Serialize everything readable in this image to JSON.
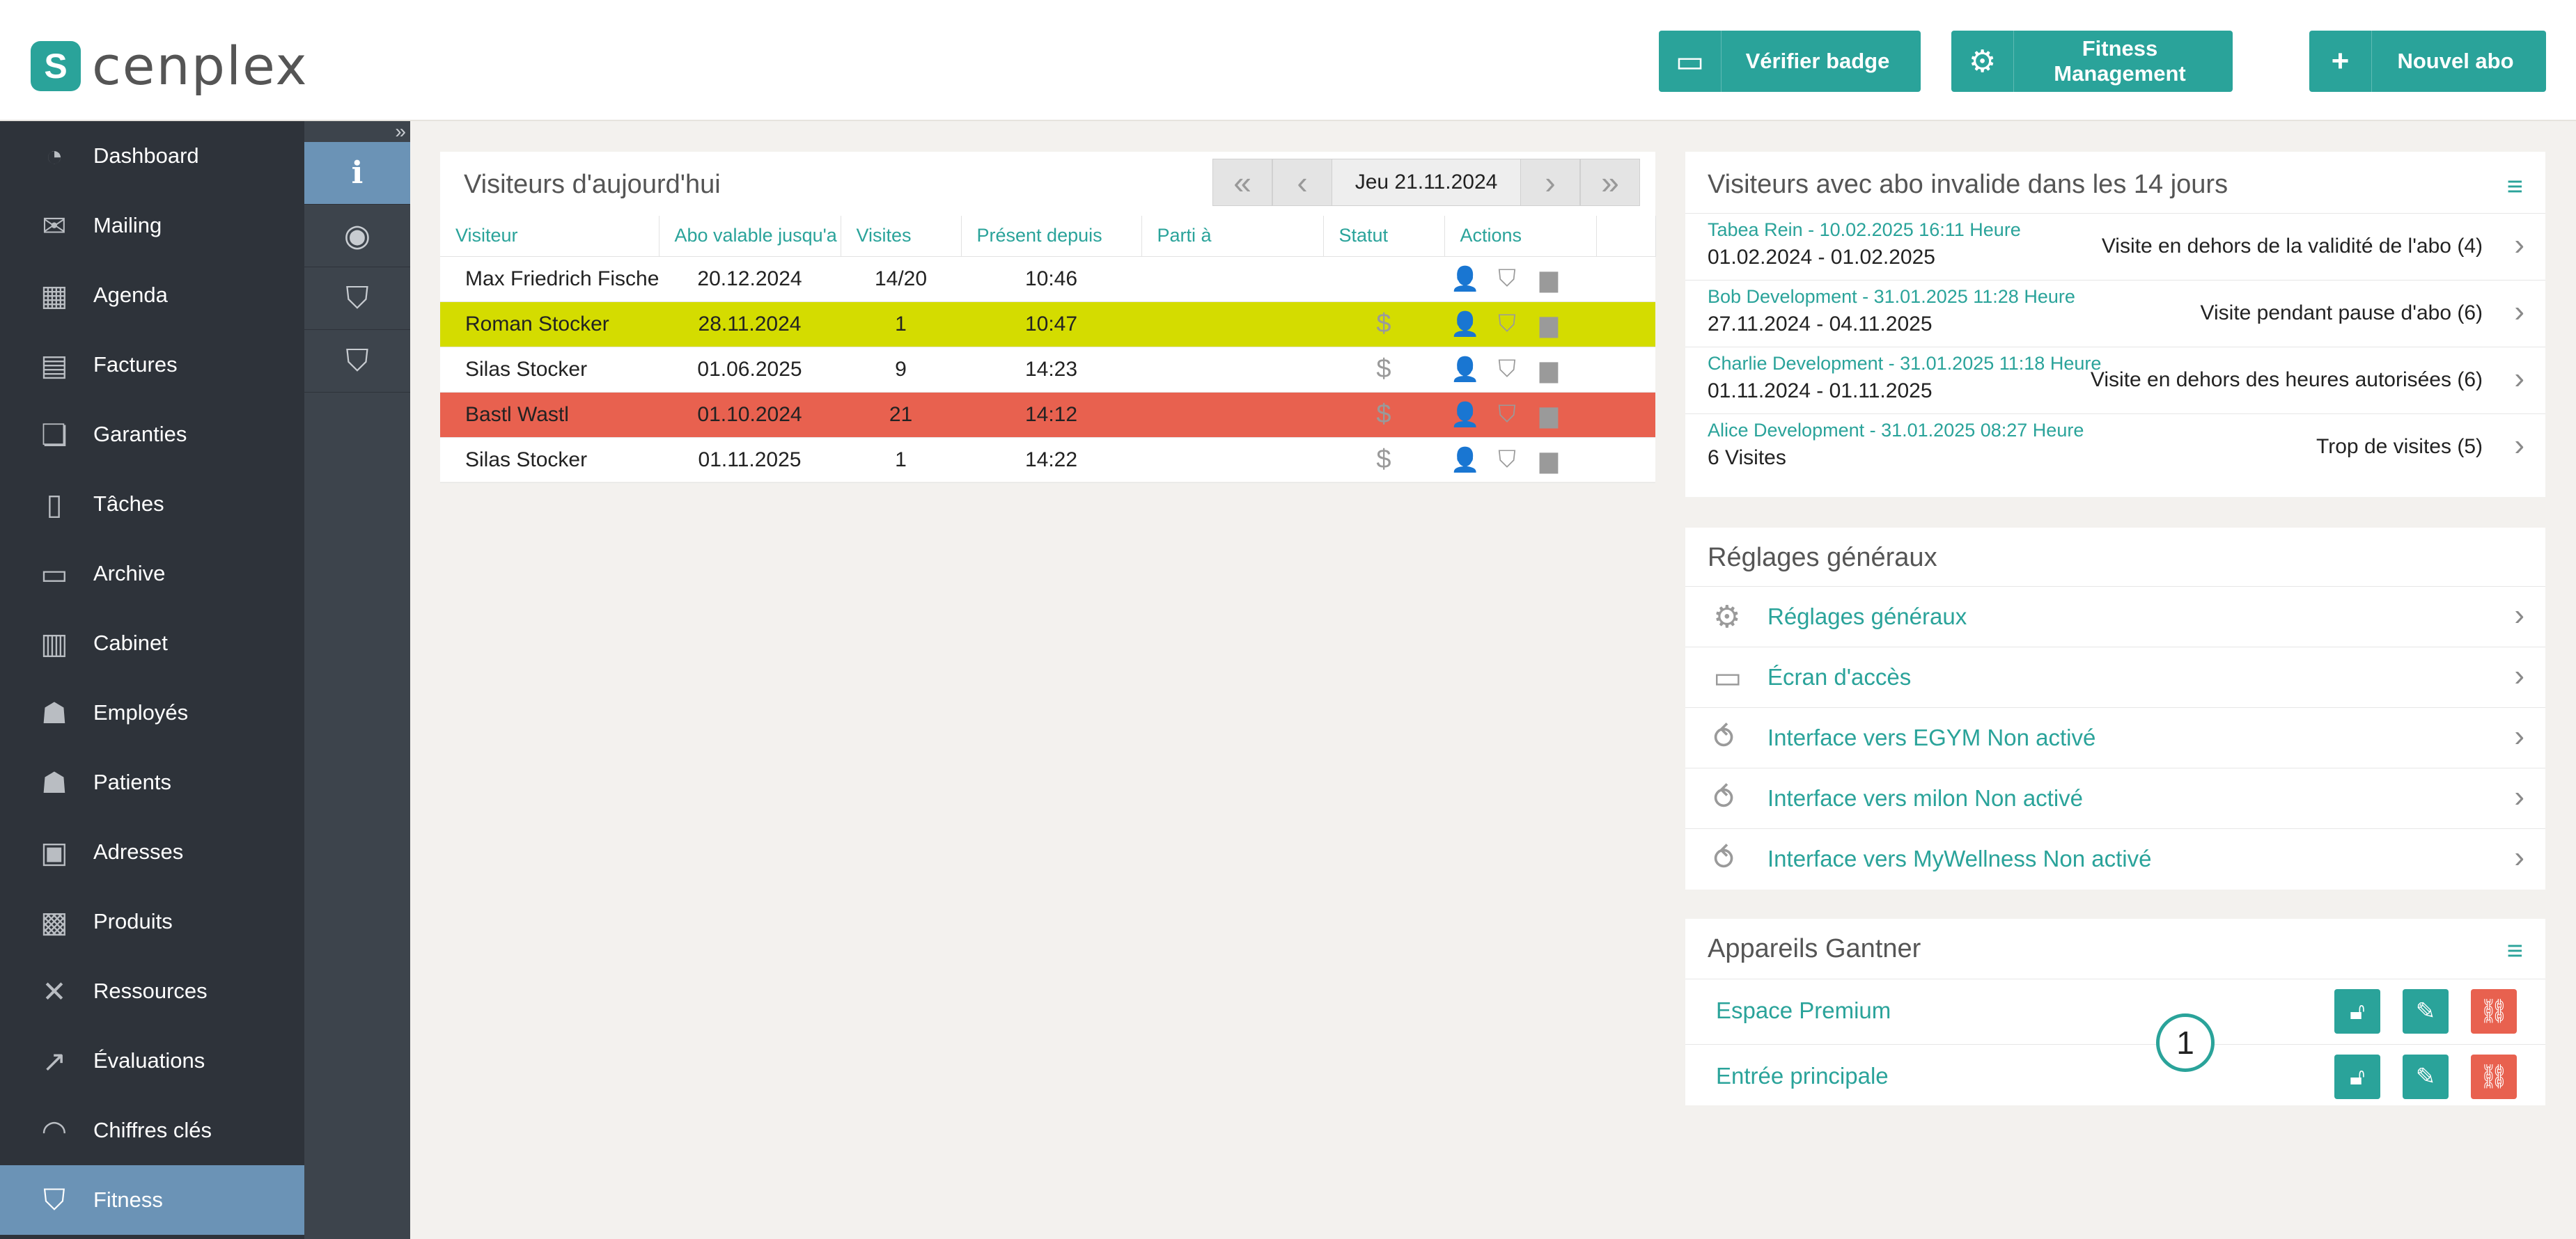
{
  "app": {
    "logo_text": "cenplex",
    "logo_mark": "S"
  },
  "header_buttons": [
    {
      "label": "Vérifier badge",
      "icon": "card-icon"
    },
    {
      "label": "Fitness Management",
      "icon": "gear-icon"
    },
    {
      "label": "Nouvel abo",
      "icon": "plus-icon"
    }
  ],
  "nav": [
    {
      "label": "Dashboard",
      "icon": "dashboard-icon",
      "glyph": "◔"
    },
    {
      "label": "Mailing",
      "icon": "mail-icon",
      "glyph": "✉"
    },
    {
      "label": "Agenda",
      "icon": "calendar-icon",
      "glyph": "▦"
    },
    {
      "label": "Factures",
      "icon": "calculator-icon",
      "glyph": "▤"
    },
    {
      "label": "Garanties",
      "icon": "document-dollar-icon",
      "glyph": "❏"
    },
    {
      "label": "Tâches",
      "icon": "clipboard-icon",
      "glyph": "▯"
    },
    {
      "label": "Archive",
      "icon": "archive-icon",
      "glyph": "▭"
    },
    {
      "label": "Cabinet",
      "icon": "building-icon",
      "glyph": "▥"
    },
    {
      "label": "Employés",
      "icon": "employees-icon",
      "glyph": "☗"
    },
    {
      "label": "Patients",
      "icon": "patients-icon",
      "glyph": "☗"
    },
    {
      "label": "Adresses",
      "icon": "address-book-icon",
      "glyph": "▣"
    },
    {
      "label": "Produits",
      "icon": "store-icon",
      "glyph": "▩"
    },
    {
      "label": "Ressources",
      "icon": "tools-icon",
      "glyph": "✕"
    },
    {
      "label": "Évaluations",
      "icon": "chart-icon",
      "glyph": "↗"
    },
    {
      "label": "Chiffres clés",
      "icon": "gauge-icon",
      "glyph": "◠"
    },
    {
      "label": "Fitness",
      "icon": "fitness-shield-icon",
      "glyph": "⛉"
    }
  ],
  "subnav": [
    {
      "icon": "info-icon",
      "glyph": "ℹ"
    },
    {
      "icon": "eye-icon",
      "glyph": "◉"
    },
    {
      "icon": "shield-icon",
      "glyph": "⛉"
    },
    {
      "icon": "shield-list-icon",
      "glyph": "⛉"
    }
  ],
  "visitors": {
    "title": "Visiteurs d'aujourd'hui",
    "date": "Jeu  21.11.2024",
    "columns": [
      "Visiteur",
      "Abo valable jusqu'a",
      "Visites",
      "Présent depuis",
      "Parti à",
      "Statut",
      "Actions"
    ],
    "rows": [
      {
        "name": "Max Friedrich Fischer",
        "valid": "20.12.2024",
        "visits": "14/20",
        "since": "10:46",
        "left": "",
        "status": ""
      },
      {
        "name": "Roman Stocker",
        "valid": "28.11.2024",
        "visits": "1",
        "since": "10:47",
        "left": "",
        "status": "$"
      },
      {
        "name": "Silas Stocker",
        "valid": "01.06.2025",
        "visits": "9",
        "since": "14:23",
        "left": "",
        "status": "$"
      },
      {
        "name": "Bastl Wastl",
        "valid": "01.10.2024",
        "visits": "21",
        "since": "14:12",
        "left": "",
        "status": "$"
      },
      {
        "name": "Silas Stocker",
        "valid": "01.11.2025",
        "visits": "1",
        "since": "14:22",
        "left": "",
        "status": "$"
      }
    ]
  },
  "invalid": {
    "title": "Visiteurs avec abo invalide dans les 14 jours",
    "rows": [
      {
        "who": "Tabea Rein - 10.02.2025 16:11 Heure",
        "period": "01.02.2024 - 01.02.2025",
        "reason": "Visite en dehors de la validité de l'abo (4)"
      },
      {
        "who": "Bob Development - 31.01.2025 11:28 Heure",
        "period": "27.11.2024 - 04.11.2025",
        "reason": "Visite pendant pause d'abo (6)"
      },
      {
        "who": "Charlie Development - 31.01.2025 11:18 Heure",
        "period": "01.11.2024 - 01.11.2025",
        "reason": "Visite en dehors des heures autorisées (6)"
      },
      {
        "who": "Alice Development - 31.01.2025 08:27 Heure",
        "period": "6 Visites",
        "reason": "Trop de visites (5)"
      }
    ]
  },
  "settings": {
    "title": "Réglages généraux",
    "rows": [
      {
        "label": "Réglages généraux",
        "icon": "gear-icon",
        "glyph": "⚙"
      },
      {
        "label": "Écran d'accès",
        "icon": "screen-icon",
        "glyph": "▭"
      },
      {
        "label": "Interface vers EGYM Non activé",
        "icon": "connector-icon",
        "glyph": "⥀"
      },
      {
        "label": "Interface vers milon Non activé",
        "icon": "connector-icon",
        "glyph": "⥀"
      },
      {
        "label": "Interface vers MyWellness Non activé",
        "icon": "connector-icon",
        "glyph": "⥀"
      }
    ]
  },
  "gantner": {
    "title": "Appareils Gantner",
    "rows": [
      {
        "label": "Espace Premium"
      },
      {
        "label": "Entrée principale"
      }
    ]
  },
  "marker": "1"
}
